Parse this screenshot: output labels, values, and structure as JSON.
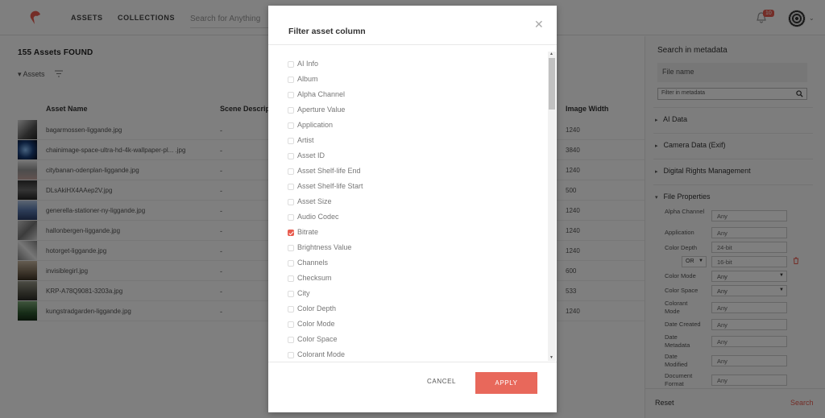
{
  "topbar": {
    "nav": [
      "ASSETS",
      "COLLECTIONS"
    ],
    "search_placeholder": "Search for Anything",
    "notification_count": "10"
  },
  "main": {
    "found": "155 Assets FOUND",
    "assets_toggle": "Assets",
    "columns": [
      "Asset Name",
      "Scene Descrip",
      "Image Width"
    ],
    "rows": [
      {
        "name": "bagarmossen-liggande.jpg",
        "scene": "-",
        "width": "1240"
      },
      {
        "name": "chainimage-space-ultra-hd-4k-wallpaper-pl... .jpg",
        "scene": "-",
        "width": "3840"
      },
      {
        "name": "citybanan-odenplan-liggande.jpg",
        "scene": "-",
        "width": "1240"
      },
      {
        "name": "DLsAkiHX4AAep2V.jpg",
        "scene": "-",
        "width": "500"
      },
      {
        "name": "generella-stationer-ny-liggande.jpg",
        "scene": "-",
        "width": "1240"
      },
      {
        "name": "hallonbergen-liggande.jpg",
        "scene": "-",
        "width": "1240"
      },
      {
        "name": "hotorget-liggande.jpg",
        "scene": "-",
        "width": "1240"
      },
      {
        "name": "invisiblegirl.jpg",
        "scene": "-",
        "width": "600"
      },
      {
        "name": "KRP-A78Q9081-3203a.jpg",
        "scene": "-",
        "width": "533"
      },
      {
        "name": "kungstradgarden-liggande.jpg",
        "scene": "-",
        "width": "1240"
      }
    ]
  },
  "right": {
    "title": "Search in metadata",
    "file_name": "File name",
    "filter_placeholder": "Filter in metadata",
    "sections": [
      "AI Data",
      "Camera Data (Exif)",
      "Digital Rights Management",
      "File Properties"
    ],
    "fields": [
      {
        "label": "Alpha Channel",
        "value": "Any"
      },
      {
        "label": "Application",
        "value": "Any"
      },
      {
        "label": "Color Depth",
        "value": "24-bit"
      },
      {
        "label": "",
        "value": "16-bit",
        "op": "OR"
      },
      {
        "label": "Color Mode",
        "value": "Any"
      },
      {
        "label": "Color Space",
        "value": "Any"
      },
      {
        "label": "Colorant Mode",
        "value": "Any"
      },
      {
        "label": "Date Created",
        "value": "Any"
      },
      {
        "label": "Date Metadata",
        "value": "Any"
      },
      {
        "label": "Date Modified",
        "value": "Any"
      },
      {
        "label": "Document Format",
        "value": "Any"
      }
    ],
    "reset": "Reset",
    "search": "Search"
  },
  "modal": {
    "title": "Filter asset column",
    "options": [
      {
        "label": "AI Info",
        "checked": false
      },
      {
        "label": "Album",
        "checked": false
      },
      {
        "label": "Alpha Channel",
        "checked": false
      },
      {
        "label": "Aperture Value",
        "checked": false
      },
      {
        "label": "Application",
        "checked": false
      },
      {
        "label": "Artist",
        "checked": false
      },
      {
        "label": "Asset ID",
        "checked": false
      },
      {
        "label": "Asset Shelf-life End",
        "checked": false
      },
      {
        "label": "Asset Shelf-life Start",
        "checked": false
      },
      {
        "label": "Asset Size",
        "checked": false
      },
      {
        "label": "Audio Codec",
        "checked": false
      },
      {
        "label": "Bitrate",
        "checked": true
      },
      {
        "label": "Brightness Value",
        "checked": false
      },
      {
        "label": "Channels",
        "checked": false
      },
      {
        "label": "Checksum",
        "checked": false
      },
      {
        "label": "City",
        "checked": false
      },
      {
        "label": "Color Depth",
        "checked": false
      },
      {
        "label": "Color Mode",
        "checked": false
      },
      {
        "label": "Color Space",
        "checked": false
      },
      {
        "label": "Colorant Mode",
        "checked": false
      }
    ],
    "cancel": "CANCEL",
    "apply": "APPLY"
  },
  "colors": {
    "accent": "#e85b4e"
  }
}
